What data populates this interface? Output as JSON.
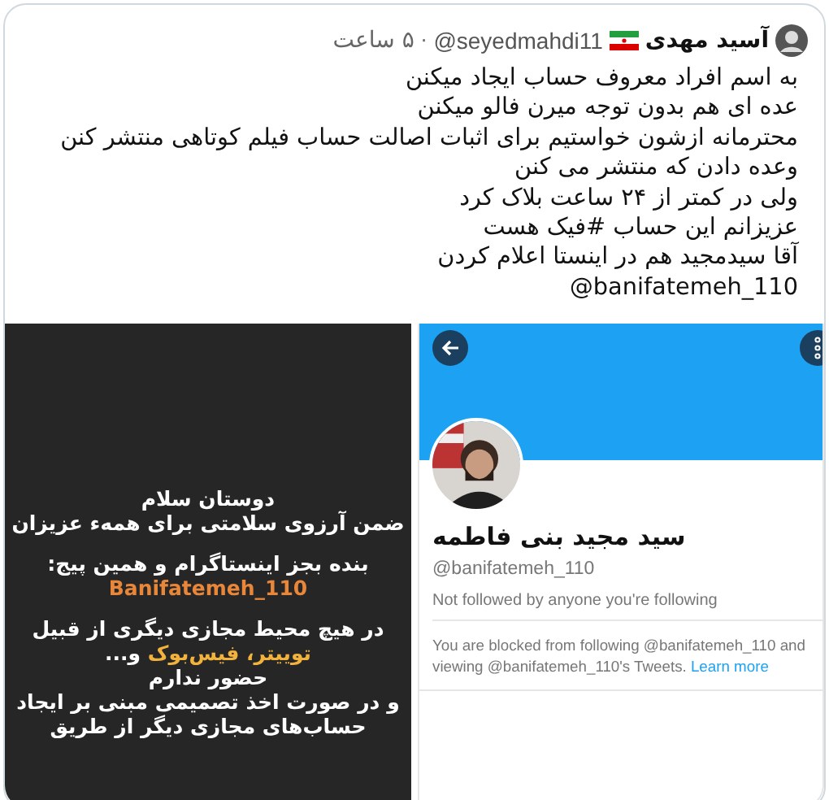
{
  "tweet": {
    "author": {
      "name": "آسید مهدی",
      "handle": "@seyedmahdi11",
      "separator": "·",
      "time": "۵ ساعت"
    },
    "lines": [
      "به اسم افراد معروف حساب ایجاد میکنن",
      "عده ای هم بدون توجه میرن فالو میکنن",
      "محترمانه ازشون خواستیم برای اثبات اصالت حساب فیلم کوتاهی منتشر کنن",
      "وعده دادن که منتشر می کنن",
      "ولی در کمتر از ۲۴ ساعت بلاک کرد",
      "عزیزانم این حساب #فیک هست",
      "آقا سیدمجید هم در اینستا اعلام کردن",
      "@banifatemeh_110"
    ],
    "media": [
      {
        "kind": "story",
        "paragraphs": [
          [
            [
              {
                "text": "دوستان سلام"
              }
            ],
            [
              {
                "text": "ضمن آرزوی سلامتی برای همهء عزیزان"
              }
            ]
          ],
          [
            [
              {
                "text": "بنده بجز اینستاگرام و همین پیج:"
              }
            ],
            [
              {
                "text": "Banifatemeh_110",
                "color": "#e8873a"
              }
            ]
          ],
          [
            [
              {
                "text": "در هیچ محیط مجازی دیگری از قبیل"
              }
            ],
            [
              {
                "text": "توییتر، فیس‌بوک",
                "color": "#f2b33d"
              },
              {
                "text": " و..."
              }
            ],
            [
              {
                "text": "حضور ندارم"
              }
            ],
            [
              {
                "text": "و در صورت اخذ تصمیمی مبنی بر ایجاد"
              }
            ],
            [
              {
                "text": "حساب‌های مجازی دیگر از طریق"
              }
            ]
          ]
        ]
      },
      {
        "kind": "profile",
        "name": "سید مجید بنی فاطمه",
        "handle": "@banifatemeh_110",
        "note": "Not followed by anyone you're following",
        "blocked_text": "You are blocked from following @banifatemeh_110 and viewing @banifatemeh_110's Tweets.",
        "link": "Learn more"
      }
    ]
  }
}
